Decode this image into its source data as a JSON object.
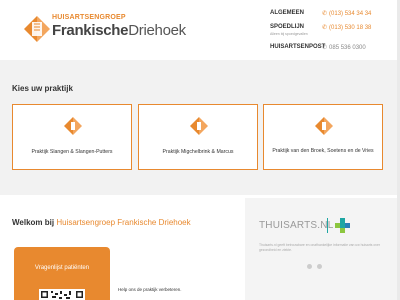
{
  "header": {
    "logo_small": "HUISARTSENGROEP",
    "logo_bold": "Frankische",
    "logo_regular": "Driehoek",
    "contact": [
      {
        "label": "ALGEMEEN",
        "value": "(013) 534 34 34"
      },
      {
        "label": "SPOEDLIJN",
        "value": "(013) 530 18 38",
        "sub": "Alleen bij spoedgevallen"
      },
      {
        "label": "HUISARTSENPOST",
        "value": "085 536 0300"
      }
    ]
  },
  "praktijk": {
    "title": "Kies uw praktijk",
    "cards": [
      {
        "label": "Praktijk Slangen & Slangen-Putters"
      },
      {
        "label": "Praktijk Migchelbrink & Marcus"
      },
      {
        "label": "Praktijk van den Broek, Soetens en de Vries"
      }
    ]
  },
  "welkom": {
    "prefix": "Welkom bij",
    "name": "Huisartsengroep Frankische Driehoek"
  },
  "vragenlijst": {
    "label": "Vragenlijst patiënten"
  },
  "help_text": "Help ons de praktijk verbeteren.",
  "thuisarts": {
    "logo": "THUISARTS.NL",
    "text": "Thuisarts.nl geeft betrouwbare en onafhankelijke informatie van uw huisarts over gezondheid en ziekte."
  },
  "colors": {
    "accent": "#e8892f",
    "teal": "#1ea6a3"
  }
}
